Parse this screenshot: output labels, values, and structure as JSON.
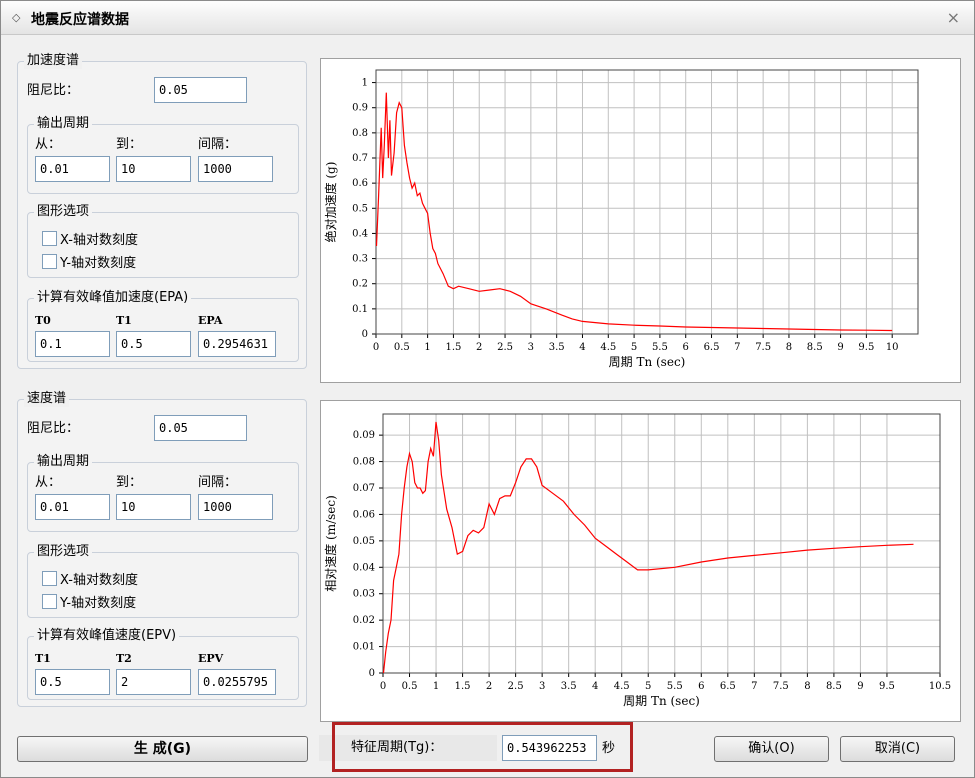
{
  "window": {
    "title": "地震反应谱数据",
    "close_glyph": "×"
  },
  "accel": {
    "group_title": "加速度谱",
    "damping_label": "阻尼比：",
    "damping_value": "0.05",
    "period_group": "输出周期",
    "from_label": "从：",
    "to_label": "到：",
    "interval_label": "间隔：",
    "from_value": "0.01",
    "to_value": "10",
    "interval_value": "1000",
    "graph_group": "图形选项",
    "xlog_label": "X-轴对数刻度",
    "ylog_label": "Y-轴对数刻度",
    "epa_group": "计算有效峰值加速度(EPA)",
    "t0_label": "T0",
    "t1_label": "T1",
    "epa_label": "EPA",
    "t0_value": "0.1",
    "t1_value": "0.5",
    "epa_value": "0.2954631"
  },
  "vel": {
    "group_title": "速度谱",
    "damping_label": "阻尼比：",
    "damping_value": "0.05",
    "period_group": "输出周期",
    "from_label": "从：",
    "to_label": "到：",
    "interval_label": "间隔：",
    "from_value": "0.01",
    "to_value": "10",
    "interval_value": "1000",
    "graph_group": "图形选项",
    "xlog_label": "X-轴对数刻度",
    "ylog_label": "Y-轴对数刻度",
    "epv_group": "计算有效峰值速度(EPV)",
    "t1_label": "T1",
    "t2_label": "T2",
    "epv_label": "EPV",
    "t1_value": "0.5",
    "t2_value": "2",
    "epv_value": "0.0255795"
  },
  "footer": {
    "generate_label": "生 成(G)",
    "tg_label": "特征周期(Tg)：",
    "tg_value": "0.543962253",
    "tg_unit": "秒",
    "ok_label": "确认(O)",
    "cancel_label": "取消(C)"
  },
  "colors": {
    "curve": "#ff0000",
    "highlight": "#b22222",
    "grid": "#c0c0c0"
  },
  "chart_data": [
    {
      "type": "line",
      "xlabel": "周期 Tn (sec)",
      "ylabel": "绝对加速度 (g)",
      "xlim": [
        0,
        10.5
      ],
      "ylim": [
        0,
        1.05
      ],
      "xticks": [
        "0",
        "0.5",
        "1",
        "1.5",
        "2",
        "2.5",
        "3",
        "3.5",
        "4",
        "4.5",
        "5",
        "5.5",
        "6",
        "6.5",
        "7",
        "7.5",
        "8",
        "8.5",
        "9",
        "9.5",
        "10"
      ],
      "yticks": [
        "0",
        "0.1",
        "0.2",
        "0.3",
        "0.4",
        "0.5",
        "0.6",
        "0.7",
        "0.8",
        "0.9",
        "1"
      ],
      "grid": true,
      "x": [
        0.01,
        0.05,
        0.1,
        0.13,
        0.16,
        0.2,
        0.24,
        0.27,
        0.3,
        0.35,
        0.4,
        0.45,
        0.5,
        0.55,
        0.6,
        0.65,
        0.7,
        0.75,
        0.8,
        0.85,
        0.9,
        0.95,
        1.0,
        1.05,
        1.1,
        1.15,
        1.2,
        1.3,
        1.4,
        1.5,
        1.6,
        1.8,
        2.0,
        2.2,
        2.4,
        2.6,
        2.8,
        3.0,
        3.3,
        3.6,
        3.8,
        4.0,
        4.5,
        5.0,
        5.5,
        6.0,
        6.5,
        7.0,
        7.5,
        8.0,
        8.5,
        9.0,
        9.5,
        10.0
      ],
      "series": [
        {
          "values": [
            0.35,
            0.55,
            0.82,
            0.62,
            0.75,
            0.96,
            0.7,
            0.85,
            0.63,
            0.72,
            0.88,
            0.92,
            0.9,
            0.75,
            0.68,
            0.62,
            0.58,
            0.6,
            0.55,
            0.56,
            0.52,
            0.5,
            0.48,
            0.4,
            0.34,
            0.32,
            0.28,
            0.24,
            0.19,
            0.18,
            0.19,
            0.18,
            0.17,
            0.175,
            0.18,
            0.17,
            0.15,
            0.12,
            0.1,
            0.075,
            0.06,
            0.05,
            0.04,
            0.035,
            0.032,
            0.028,
            0.026,
            0.024,
            0.022,
            0.02,
            0.018,
            0.016,
            0.015,
            0.014
          ]
        }
      ]
    },
    {
      "type": "line",
      "xlabel": "周期 Tn (sec)",
      "ylabel": "相对速度 (m/sec)",
      "xlim": [
        0,
        10.5
      ],
      "ylim": [
        0,
        0.098
      ],
      "xticks": [
        "0",
        "0.5",
        "1",
        "1.5",
        "2",
        "2.5",
        "3",
        "3.5",
        "4",
        "4.5",
        "5",
        "5.5",
        "6",
        "6.5",
        "7",
        "7.5",
        "8",
        "8.5",
        "9",
        "9.5",
        "10.5"
      ],
      "yticks": [
        "0",
        "0.01",
        "0.02",
        "0.03",
        "0.04",
        "0.05",
        "0.06",
        "0.07",
        "0.08",
        "0.09"
      ],
      "grid": true,
      "x": [
        0.01,
        0.05,
        0.1,
        0.15,
        0.2,
        0.25,
        0.3,
        0.35,
        0.4,
        0.45,
        0.5,
        0.55,
        0.6,
        0.65,
        0.7,
        0.75,
        0.8,
        0.85,
        0.9,
        0.95,
        1.0,
        1.05,
        1.1,
        1.2,
        1.3,
        1.4,
        1.5,
        1.6,
        1.7,
        1.8,
        1.9,
        2.0,
        2.1,
        2.2,
        2.3,
        2.4,
        2.5,
        2.6,
        2.7,
        2.8,
        2.9,
        3.0,
        3.2,
        3.4,
        3.6,
        3.8,
        4.0,
        4.2,
        4.4,
        4.6,
        4.8,
        5.0,
        5.5,
        6.0,
        6.5,
        7.0,
        7.5,
        8.0,
        8.5,
        9.0,
        9.5,
        10.0
      ],
      "series": [
        {
          "values": [
            0.0,
            0.008,
            0.015,
            0.02,
            0.035,
            0.04,
            0.045,
            0.06,
            0.07,
            0.078,
            0.083,
            0.08,
            0.072,
            0.07,
            0.07,
            0.068,
            0.069,
            0.08,
            0.085,
            0.082,
            0.095,
            0.088,
            0.075,
            0.062,
            0.055,
            0.045,
            0.046,
            0.052,
            0.054,
            0.053,
            0.055,
            0.064,
            0.06,
            0.066,
            0.067,
            0.067,
            0.072,
            0.078,
            0.081,
            0.081,
            0.078,
            0.071,
            0.068,
            0.065,
            0.06,
            0.056,
            0.051,
            0.048,
            0.045,
            0.042,
            0.039,
            0.039,
            0.04,
            0.042,
            0.0435,
            0.0445,
            0.0455,
            0.0465,
            0.0472,
            0.0478,
            0.0483,
            0.0487
          ]
        }
      ]
    }
  ]
}
